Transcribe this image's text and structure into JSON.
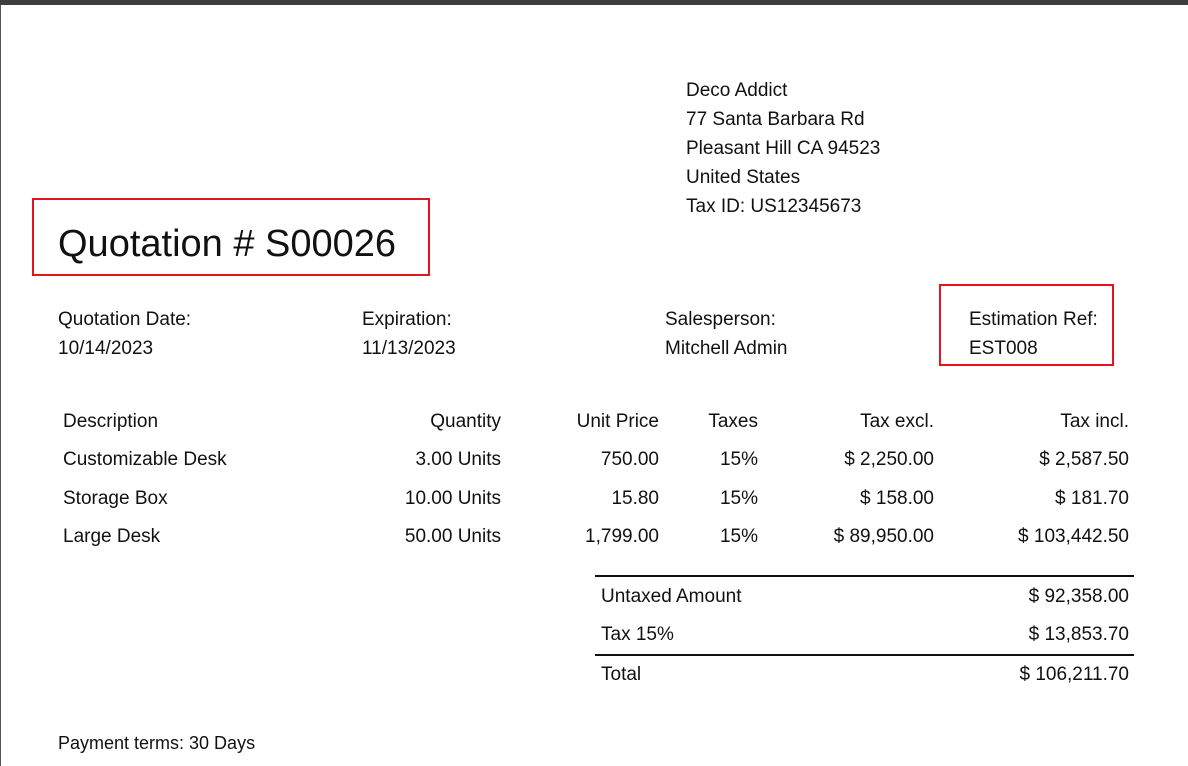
{
  "customer": {
    "name": "Deco Addict",
    "street": "77 Santa Barbara Rd",
    "city_line": "Pleasant Hill CA 94523",
    "country": "United States",
    "tax_id": "Tax ID: US12345673"
  },
  "title": "Quotation # S00026",
  "info": {
    "quotation_date_label": "Quotation Date:",
    "quotation_date": "10/14/2023",
    "expiration_label": "Expiration:",
    "expiration": "11/13/2023",
    "salesperson_label": "Salesperson:",
    "salesperson": "Mitchell Admin",
    "estimation_ref_label": "Estimation Ref:",
    "estimation_ref": "EST008"
  },
  "table": {
    "headers": [
      "Description",
      "Quantity",
      "Unit Price",
      "Taxes",
      "Tax excl.",
      "Tax incl."
    ],
    "rows": [
      [
        "Customizable Desk",
        "3.00 Units",
        "750.00",
        "15%",
        "$ 2,250.00",
        "$ 2,587.50"
      ],
      [
        "Storage Box",
        "10.00 Units",
        "15.80",
        "15%",
        "$ 158.00",
        "$ 181.70"
      ],
      [
        "Large Desk",
        "50.00 Units",
        "1,799.00",
        "15%",
        "$ 89,950.00",
        "$ 103,442.50"
      ]
    ]
  },
  "totals": {
    "untaxed_label": "Untaxed Amount",
    "untaxed_value": "$ 92,358.00",
    "tax_label": "Tax 15%",
    "tax_value": "$ 13,853.70",
    "total_label": "Total",
    "total_value": "$ 106,211.70"
  },
  "payment_terms": "Payment terms: 30 Days",
  "colors": {
    "highlight": "#e3141b"
  }
}
